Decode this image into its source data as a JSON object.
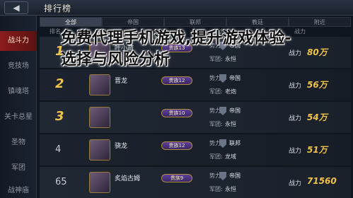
{
  "header": {
    "back_label": "◀",
    "title": "排行榜"
  },
  "nav": [
    {
      "label": "战斗力",
      "active": true
    },
    {
      "label": "竞技场"
    },
    {
      "label": "镇魂塔"
    },
    {
      "label": "关卡总星"
    },
    {
      "label": "圣物"
    },
    {
      "label": "军团"
    },
    {
      "label": "战神庙"
    }
  ],
  "filters": [
    {
      "label": "全部",
      "active": true
    },
    {
      "label": "帝国"
    },
    {
      "label": "联邦"
    },
    {
      "label": "教廷"
    },
    {
      "label": "附近"
    }
  ],
  "columns": {
    "rank": "排名",
    "name": "名称",
    "faction": "势力",
    "power": "战力"
  },
  "rows": [
    {
      "rank": "1",
      "name": "叶小疏",
      "badge": "贵族13",
      "faction_label": "势力:",
      "faction": "帝国",
      "legion_label": "军团:",
      "legion": "永恒",
      "power_label": "战力",
      "power": "80万"
    },
    {
      "rank": "2",
      "name": "晋龙",
      "badge": "贵族12",
      "faction_label": "势力:",
      "faction": "帝国",
      "legion_label": "军团:",
      "legion": "老炮",
      "power_label": "战力",
      "power": "56万"
    },
    {
      "rank": "3",
      "name": "",
      "badge": "贵族10",
      "faction_label": "势力:",
      "faction": "帝国",
      "legion_label": "军团:",
      "legion": "永恒",
      "power_label": "战力",
      "power": "54万"
    },
    {
      "rank": "4",
      "name": "骁龙",
      "badge": "贵族12",
      "faction_label": "势力:",
      "faction": "联邦",
      "legion_label": "军团:",
      "legion": "龙域",
      "power_label": "战力",
      "power": "51万"
    },
    {
      "rank": "65",
      "name": "炙焰古姆",
      "badge": "贵族9",
      "faction_label": "势力:",
      "faction": "帝国",
      "legion_label": "军团:",
      "legion": "永恒",
      "power_label": "战力",
      "power": "71560"
    }
  ],
  "overlay_text": "免费代理手机游戏,提升游戏体验-选择与风险分析"
}
